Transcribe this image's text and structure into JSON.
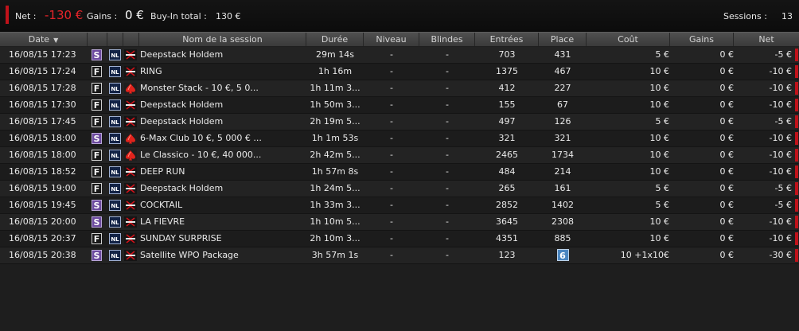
{
  "summary": {
    "net_label": "Net :",
    "net_value": "-130 €",
    "gains_label": "Gains :",
    "gains_value": "0 €",
    "buyin_label": "Buy-In total :",
    "buyin_value": "130 €",
    "sessions_label": "Sessions :",
    "sessions_value": "13"
  },
  "columns": {
    "date": "Date",
    "name": "Nom de la session",
    "duration": "Durée",
    "level": "Niveau",
    "blinds": "Blindes",
    "entries": "Entrées",
    "place": "Place",
    "cost": "Coût",
    "gains": "Gains",
    "net": "Net"
  },
  "colors": {
    "accent": "#c0121a",
    "loss": "#e8242a",
    "sit_badge": "#6c4a9e",
    "place_highlight": "#4a86c0"
  },
  "icons": {
    "limit_badge": "nl-badge",
    "room_a": "poker-room-logo",
    "room_b": "spade-logo"
  },
  "rows": [
    {
      "date": "16/08/15 17:23",
      "type": "S",
      "limit": "NL",
      "room": "a",
      "name": "Deepstack Holdem",
      "duration": "29m 14s",
      "level": "-",
      "blinds": "-",
      "entries": "703",
      "place": "431",
      "cost": "5 €",
      "gains": "0 €",
      "net": "-5 €"
    },
    {
      "date": "16/08/15 17:24",
      "type": "F",
      "limit": "NL",
      "room": "a",
      "name": "RING",
      "duration": "1h 16m",
      "level": "-",
      "blinds": "-",
      "entries": "1375",
      "place": "467",
      "cost": "10 €",
      "gains": "0 €",
      "net": "-10 €"
    },
    {
      "date": "16/08/15 17:28",
      "type": "F",
      "limit": "NL",
      "room": "b",
      "name": "Monster Stack - 10 €, 5 0...",
      "duration": "1h 11m 3...",
      "level": "-",
      "blinds": "-",
      "entries": "412",
      "place": "227",
      "cost": "10 €",
      "gains": "0 €",
      "net": "-10 €"
    },
    {
      "date": "16/08/15 17:30",
      "type": "F",
      "limit": "NL",
      "room": "a",
      "name": "Deepstack Holdem",
      "duration": "1h 50m 3...",
      "level": "-",
      "blinds": "-",
      "entries": "155",
      "place": "67",
      "cost": "10 €",
      "gains": "0 €",
      "net": "-10 €"
    },
    {
      "date": "16/08/15 17:45",
      "type": "F",
      "limit": "NL",
      "room": "a",
      "name": "Deepstack Holdem",
      "duration": "2h 19m 5...",
      "level": "-",
      "blinds": "-",
      "entries": "497",
      "place": "126",
      "cost": "5 €",
      "gains": "0 €",
      "net": "-5 €"
    },
    {
      "date": "16/08/15 18:00",
      "type": "S",
      "limit": "NL",
      "room": "b",
      "name": "6-Max Club 10 €, 5 000 € ...",
      "duration": "1h 1m 53s",
      "level": "-",
      "blinds": "-",
      "entries": "321",
      "place": "321",
      "cost": "10 €",
      "gains": "0 €",
      "net": "-10 €"
    },
    {
      "date": "16/08/15 18:00",
      "type": "F",
      "limit": "NL",
      "room": "b",
      "name": "Le Classico - 10 €, 40 000...",
      "duration": "2h 42m 5...",
      "level": "-",
      "blinds": "-",
      "entries": "2465",
      "place": "1734",
      "cost": "10 €",
      "gains": "0 €",
      "net": "-10 €"
    },
    {
      "date": "16/08/15 18:52",
      "type": "F",
      "limit": "NL",
      "room": "a",
      "name": "DEEP RUN",
      "duration": "1h 57m 8s",
      "level": "-",
      "blinds": "-",
      "entries": "484",
      "place": "214",
      "cost": "10 €",
      "gains": "0 €",
      "net": "-10 €"
    },
    {
      "date": "16/08/15 19:00",
      "type": "F",
      "limit": "NL",
      "room": "a",
      "name": "Deepstack Holdem",
      "duration": "1h 24m 5...",
      "level": "-",
      "blinds": "-",
      "entries": "265",
      "place": "161",
      "cost": "5 €",
      "gains": "0 €",
      "net": "-5 €"
    },
    {
      "date": "16/08/15 19:45",
      "type": "S",
      "limit": "NL",
      "room": "a",
      "name": "COCKTAIL",
      "duration": "1h 33m 3...",
      "level": "-",
      "blinds": "-",
      "entries": "2852",
      "place": "1402",
      "cost": "5 €",
      "gains": "0 €",
      "net": "-5 €"
    },
    {
      "date": "16/08/15 20:00",
      "type": "S",
      "limit": "NL",
      "room": "a",
      "name": "LA FIEVRE",
      "duration": "1h 10m 5...",
      "level": "-",
      "blinds": "-",
      "entries": "3645",
      "place": "2308",
      "cost": "10 €",
      "gains": "0 €",
      "net": "-10 €"
    },
    {
      "date": "16/08/15 20:37",
      "type": "F",
      "limit": "NL",
      "room": "a",
      "name": "SUNDAY SURPRISE",
      "duration": "2h 10m 3...",
      "level": "-",
      "blinds": "-",
      "entries": "4351",
      "place": "885",
      "cost": "10 €",
      "gains": "0 €",
      "net": "-10 €"
    },
    {
      "date": "16/08/15 20:38",
      "type": "S",
      "limit": "NL",
      "room": "a",
      "name": "Satellite WPO Package",
      "duration": "3h 57m 1s",
      "level": "-",
      "blinds": "-",
      "entries": "123",
      "place": "6",
      "place_highlight": true,
      "cost": "10  +1x10€",
      "gains": "0 €",
      "net": "-30 €"
    }
  ]
}
